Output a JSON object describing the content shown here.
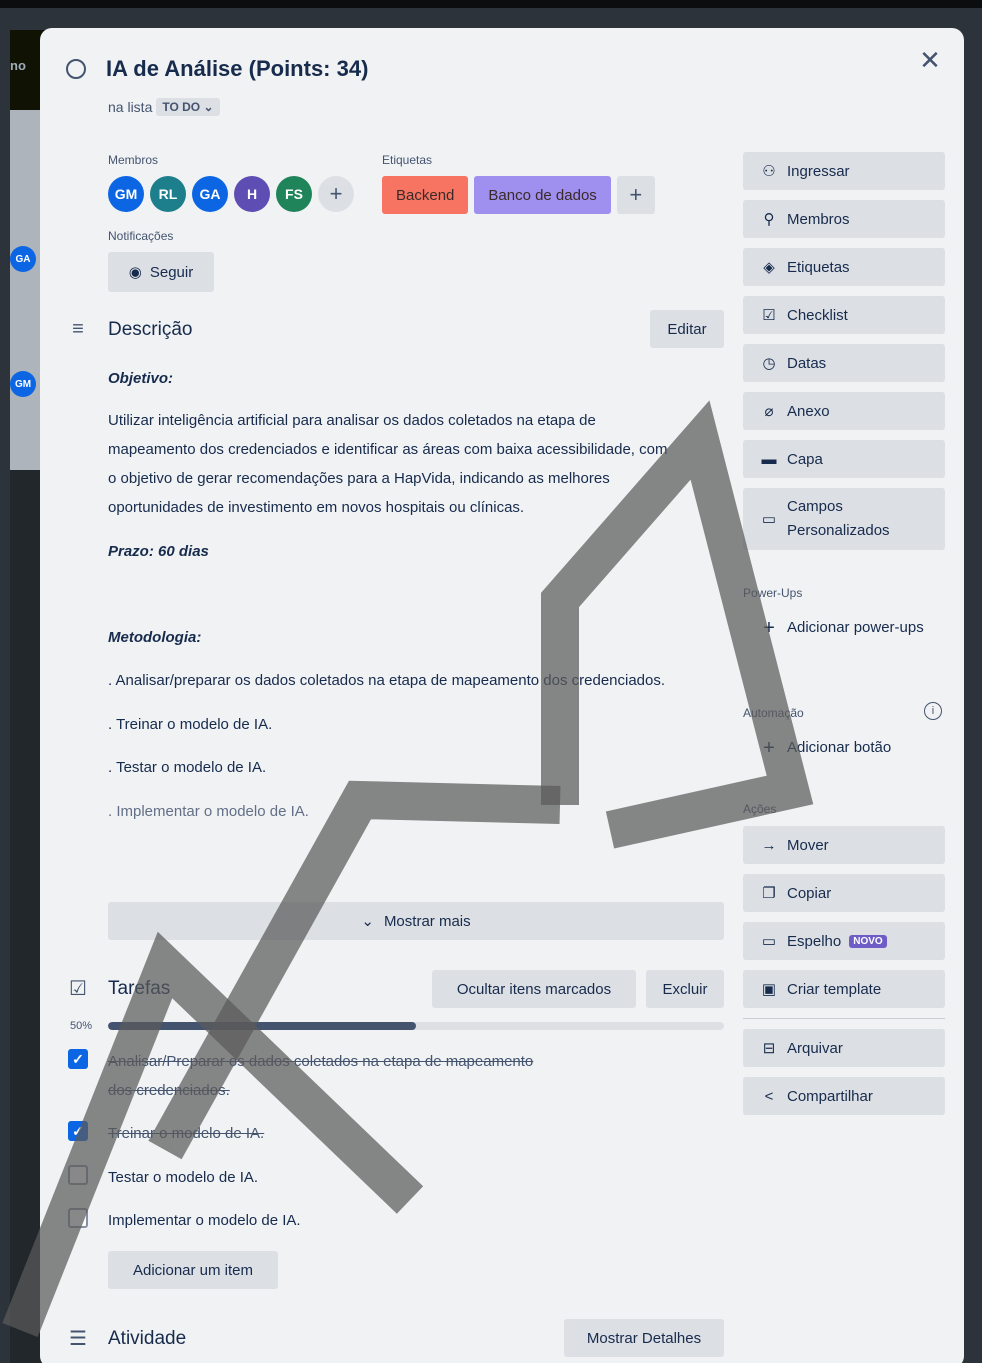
{
  "background": {
    "left_fragment_text": "no",
    "avatars": [
      "GA",
      "GM"
    ]
  },
  "card": {
    "title": "IA de Análise (Points: 34)",
    "in_list_prefix": "na lista",
    "list_name": "TO DO",
    "close_icon": "close-icon"
  },
  "members": {
    "label": "Membros",
    "avatars": [
      {
        "initials": "GM",
        "color": "#0c66e4"
      },
      {
        "initials": "RL",
        "color": "#1d7f8c"
      },
      {
        "initials": "GA",
        "color": "#0c66e4"
      },
      {
        "initials": "H",
        "color": "#5e4db2"
      },
      {
        "initials": "FS",
        "color": "#1f845a"
      }
    ]
  },
  "labels": {
    "label": "Etiquetas",
    "items": [
      {
        "text": "Backend",
        "color": "#f87462"
      },
      {
        "text": "Banco de dados",
        "color": "#9f8fef"
      }
    ]
  },
  "notifications": {
    "label": "Notificações",
    "follow_label": "Seguir"
  },
  "description": {
    "title": "Descrição",
    "edit_label": "Editar",
    "objective_heading": "Objetivo:",
    "objective_text_lines": [
      "Utilizar inteligência artificial para analisar os dados coletados na etapa de",
      "mapeamento dos credenciados e identificar as áreas com baixa acessibilidade, com",
      "o objetivo de gerar recomendações para a HapVida, indicando as melhores",
      "oportunidades de investimento em novos hospitais ou clínicas."
    ],
    "deadline": "Prazo: 60 dias",
    "methodology_heading": "Metodologia:",
    "methodology_items": [
      ". Analisar/preparar os dados coletados na etapa de mapeamento dos credenciados.",
      ". Treinar o modelo de IA.",
      ". Testar o modelo de IA.",
      ". Implementar o modelo de IA."
    ],
    "show_more_label": "Mostrar mais"
  },
  "checklist": {
    "title": "Tarefas",
    "hide_checked_label": "Ocultar itens marcados",
    "delete_label": "Excluir",
    "progress_label": "50%",
    "progress": 0.5,
    "items": [
      {
        "lines": [
          "Analisar/Preparar os dados coletados na etapa de mapeamento",
          "dos credenciados."
        ],
        "checked": true
      },
      {
        "lines": [
          "Treinar o modelo de IA."
        ],
        "checked": true
      },
      {
        "lines": [
          "Testar o modelo de IA."
        ],
        "checked": false
      },
      {
        "lines": [
          "Implementar o modelo de IA."
        ],
        "checked": false
      }
    ],
    "add_item_label": "Adicionar um item"
  },
  "activity": {
    "title": "Atividade",
    "show_details_label": "Mostrar Detalhes"
  },
  "sidebar": {
    "add_to_card": [
      {
        "label": "Ingressar",
        "icon": "join-icon"
      },
      {
        "label": "Membros",
        "icon": "member-icon"
      },
      {
        "label": "Etiquetas",
        "icon": "label-icon"
      },
      {
        "label": "Checklist",
        "icon": "checklist-icon"
      },
      {
        "label": "Datas",
        "icon": "clock-icon"
      },
      {
        "label": "Anexo",
        "icon": "attachment-icon"
      },
      {
        "label": "Capa",
        "icon": "cover-icon"
      },
      {
        "label": "Campos Personalizados",
        "icon": "custom-fields-icon"
      }
    ],
    "powerups_label": "Power-Ups",
    "add_powerups_label": "Adicionar power-ups",
    "automation_label": "Automação",
    "add_button_label": "Adicionar botão",
    "actions_label": "Ações",
    "actions": [
      {
        "label": "Mover",
        "icon": "arrow-right-icon"
      },
      {
        "label": "Copiar",
        "icon": "copy-icon"
      },
      {
        "label": "Espelho",
        "icon": "mirror-icon",
        "badge": "NOVO"
      },
      {
        "label": "Criar template",
        "icon": "template-icon"
      },
      {
        "label": "Arquivar",
        "icon": "archive-icon"
      },
      {
        "label": "Compartilhar",
        "icon": "share-icon"
      }
    ]
  },
  "colors": {
    "accent_blue": "#0c66e4",
    "modal_bg": "#f1f2f4",
    "button_bg": "#dcdfe4",
    "text": "#172b4d",
    "badge_purple": "#6e5dc6"
  }
}
